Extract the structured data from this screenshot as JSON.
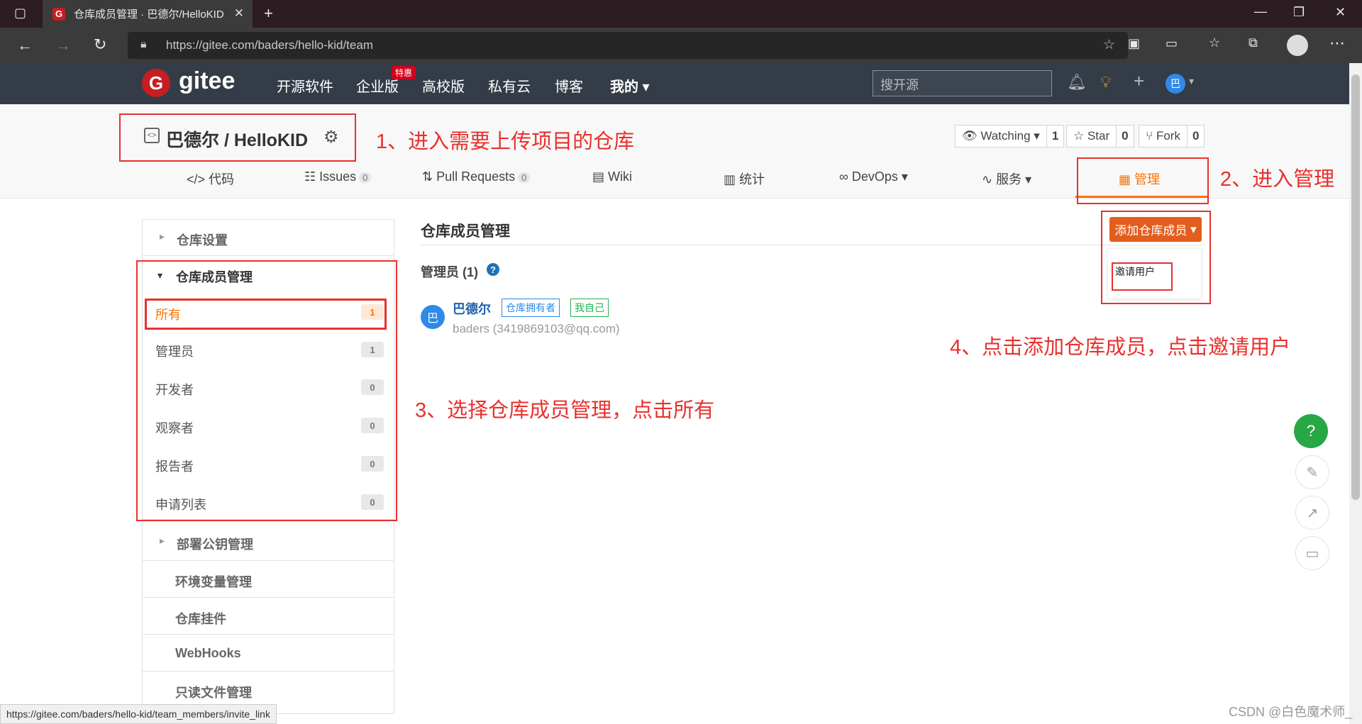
{
  "browser": {
    "tab_title": "仓库成员管理 · 巴德尔/HelloKID",
    "url": "https://gitee.com/baders/hello-kid/team",
    "status_url": "https://gitee.com/baders/hello-kid/team_members/invite_link"
  },
  "header": {
    "logo_letter": "G",
    "logo_text": "gitee",
    "nav": [
      "开源软件",
      "企业版",
      "高校版",
      "私有云",
      "博客",
      "我的"
    ],
    "hot_badge": "特惠",
    "search_placeholder": "搜开源",
    "avatar_letter": "巴"
  },
  "repo": {
    "title": "巴德尔 / HelloKID",
    "watching_label": "Watching",
    "watching_count": "1",
    "star_label": "Star",
    "star_count": "0",
    "fork_label": "Fork",
    "fork_count": "0",
    "tabs": [
      {
        "label": "代码"
      },
      {
        "label": "Issues",
        "count": "0"
      },
      {
        "label": "Pull Requests",
        "count": "0"
      },
      {
        "label": "Wiki"
      },
      {
        "label": "统计"
      },
      {
        "label": "DevOps"
      },
      {
        "label": "服务"
      },
      {
        "label": "管理"
      }
    ]
  },
  "sidebar": {
    "repo_settings": "仓库设置",
    "members_group": "仓库成员管理",
    "members": [
      {
        "label": "所有",
        "count": "1"
      },
      {
        "label": "管理员",
        "count": "1"
      },
      {
        "label": "开发者",
        "count": "0"
      },
      {
        "label": "观察者",
        "count": "0"
      },
      {
        "label": "报告者",
        "count": "0"
      },
      {
        "label": "申请列表",
        "count": "0"
      }
    ],
    "deploy_keys": "部署公钥管理",
    "env_vars": "环境变量管理",
    "hooks": "仓库挂件",
    "webhooks": "WebHooks",
    "readonly_files": "只读文件管理"
  },
  "main": {
    "title": "仓库成员管理",
    "add_button": "添加仓库成员",
    "dropdown_item": "邀请用户",
    "admin_section": "管理员 (1)",
    "member": {
      "avatar": "巴",
      "name": "巴德尔",
      "tag_owner": "仓库拥有者",
      "tag_self": "我自己",
      "email": "baders (3419869103@qq.com)"
    }
  },
  "annotations": {
    "step1": "1、进入需要上传项目的仓库",
    "step2": "2、进入管理",
    "step3": "3、选择仓库成员管理，点击所有",
    "step4": "4、点击添加仓库成员，点击邀请用户"
  },
  "watermark": "CSDN @白色魔术师_",
  "colors": {
    "brand_red": "#c71d23",
    "active_orange": "#fe7300",
    "annotation_red": "#e9302d",
    "header_bg": "#343c47"
  }
}
